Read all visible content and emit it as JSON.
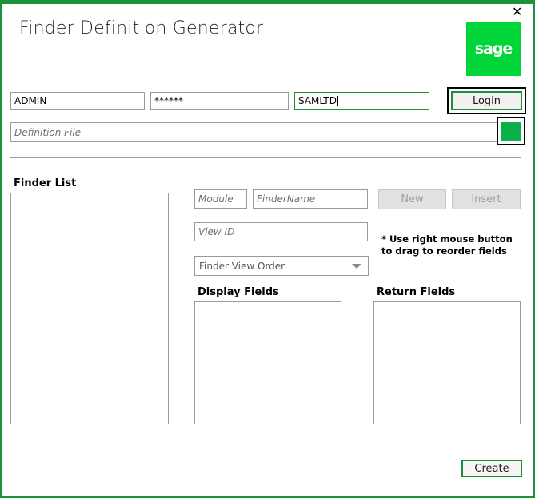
{
  "window": {
    "title": "Finder Definition Generator",
    "close_glyph": "✕",
    "logo_text": "sage",
    "accent_color": "#1e8f3a",
    "logo_color": "#00d639"
  },
  "login": {
    "user_value": "ADMIN",
    "password_value": "******",
    "company_value": "SAMLTD",
    "login_label": "Login"
  },
  "definition": {
    "placeholder": "Definition File"
  },
  "finder_list": {
    "heading": "Finder List"
  },
  "form": {
    "module_placeholder": "Module",
    "findername_placeholder": "FinderName",
    "new_label": "New",
    "insert_label": "Insert",
    "viewid_placeholder": "View ID",
    "note": "* Use right mouse button to drag to reorder fields",
    "order_selected": "Finder View Order"
  },
  "display_fields": {
    "heading": "Display Fields"
  },
  "return_fields": {
    "heading": "Return Fields"
  },
  "footer": {
    "create_label": "Create"
  }
}
